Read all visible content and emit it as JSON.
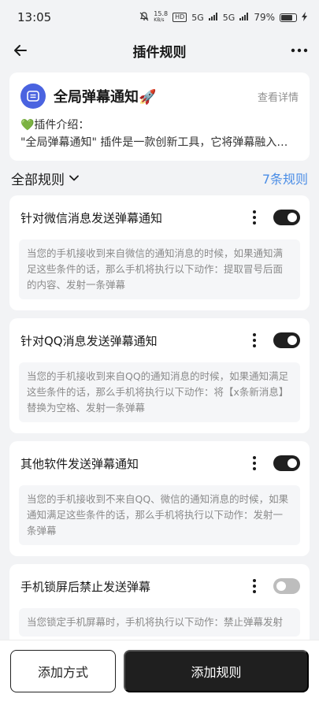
{
  "status_bar": {
    "time": "13:05",
    "network_speed": "15.8",
    "network_unit": "KB/s",
    "hd": "HD",
    "signal_1": "5G",
    "signal_2": "5G",
    "battery_percent": "79%"
  },
  "nav": {
    "title": "插件规则",
    "back_icon": "arrow-left-icon",
    "more_icon": "more-horizontal-icon"
  },
  "plugin": {
    "name": "全局弹幕通知🚀",
    "detail_link": "查看详情",
    "intro_label": "💚插件介绍：",
    "intro_text": "\"全局弹幕通知\" 插件是一款创新工具，它将弹幕融入通知之中"
  },
  "rules_header": {
    "filter_label": "全部规则",
    "count": "7条规则"
  },
  "rules": [
    {
      "title": "针对微信消息发送弹幕通知",
      "enabled": true,
      "description": "当您的手机接收到来自微信的通知消息的时候，如果通知满足这些条件的话，那么手机将执行以下动作：提取冒号后面的内容、发射一条弹幕"
    },
    {
      "title": "针对QQ消息发送弹幕通知",
      "enabled": true,
      "description": "当您的手机接收到来自QQ的通知消息的时候，如果通知满足这些条件的话，那么手机将执行以下动作：将【x条新消息】替换为空格、发射一条弹幕"
    },
    {
      "title": "其他软件发送弹幕通知",
      "enabled": true,
      "description": "当您的手机接收到不来自QQ、微信的通知消息的时候，如果通知满足这些条件的话，那么手机将执行以下动作：发射一条弹幕"
    },
    {
      "title": "手机锁屏后禁止发送弹幕",
      "enabled": false,
      "description": "当您锁定手机屏幕时，手机将执行以下动作：禁止弹幕发射"
    }
  ],
  "bottom": {
    "add_method_label": "添加方式",
    "add_rule_label": "添加规则"
  },
  "colors": {
    "accent_blue": "#4a8de6",
    "toggle_on": "#1f1f1f",
    "toggle_off": "#bdbdbd",
    "plugin_logo": "#4a63e0"
  }
}
